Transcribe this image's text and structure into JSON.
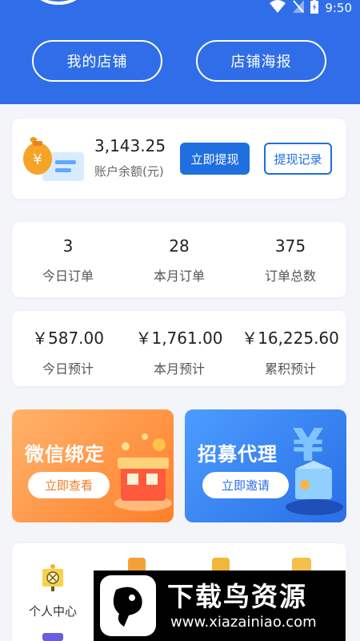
{
  "status_bar": {
    "time": "9:50"
  },
  "header": {
    "my_shop_label": "我的店铺",
    "shop_poster_label": "店铺海报"
  },
  "balance": {
    "amount": "3,143.25",
    "label": "账户余额(元)",
    "withdraw_label": "立即提现",
    "withdraw_record_label": "提现记录"
  },
  "orders": [
    {
      "value": "3",
      "label": "今日订单"
    },
    {
      "value": "28",
      "label": "本月订单"
    },
    {
      "value": "375",
      "label": "订单总数"
    }
  ],
  "estimates": [
    {
      "value": "￥587.00",
      "label": "今日预计"
    },
    {
      "value": "￥1,761.00",
      "label": "本月预计"
    },
    {
      "value": "￥16,225.60",
      "label": "累积预计"
    }
  ],
  "promos": {
    "wechat": {
      "title": "微信绑定",
      "action": "立即查看"
    },
    "agent": {
      "title": "招募代理",
      "action": "立即邀请"
    }
  },
  "menu": {
    "personal_center": "个人中心"
  },
  "watermark": {
    "title": "下载鸟资源",
    "url": "www.xiazainiao.com"
  }
}
